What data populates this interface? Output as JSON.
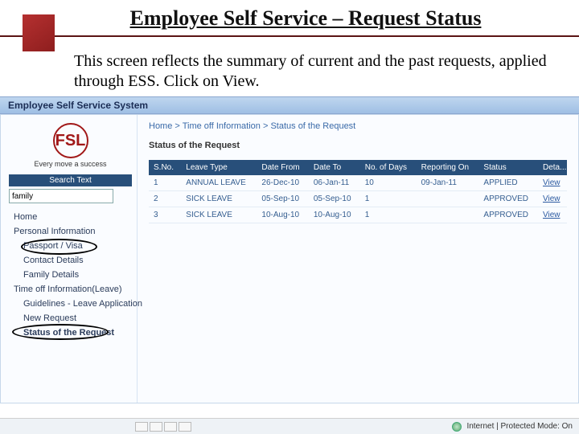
{
  "slide": {
    "title": "Employee Self Service – Request Status",
    "description": "This screen reflects the summary of current and the past requests, applied through ESS. Click on View."
  },
  "titlebar": "Employee Self Service System",
  "logo": {
    "text": "FSL",
    "tagline": "Every move a success"
  },
  "search": {
    "label": "Search Text",
    "value": "family"
  },
  "nav": {
    "home": "Home",
    "personal_info": "Personal Information",
    "passport": "Passport / Visa",
    "contact": "Contact Details",
    "family": "Family Details",
    "timeoff": "Time off Information(Leave)",
    "guidelines": "Guidelines - Leave Application",
    "newreq": "New Request",
    "status": "Status of the Request"
  },
  "breadcrumb": {
    "home": "Home",
    "timeoff": "Time off Information",
    "last": "Status of the Request"
  },
  "subheading": "Status of the Request",
  "table": {
    "headers": {
      "sno": "S.No.",
      "type": "Leave Type",
      "from": "Date From",
      "to": "Date To",
      "days": "No. of Days",
      "repon": "Reporting On",
      "status": "Status",
      "deta": "Deta..."
    },
    "rows": [
      {
        "sno": "1",
        "type": "ANNUAL LEAVE",
        "from": "26-Dec-10",
        "to": "06-Jan-11",
        "days": "10",
        "repon": "09-Jan-11",
        "status": "APPLIED",
        "view": "View"
      },
      {
        "sno": "2",
        "type": "SICK LEAVE",
        "from": "05-Sep-10",
        "to": "05-Sep-10",
        "days": "1",
        "repon": "",
        "status": "APPROVED",
        "view": "View"
      },
      {
        "sno": "3",
        "type": "SICK LEAVE",
        "from": "10-Aug-10",
        "to": "10-Aug-10",
        "days": "1",
        "repon": "",
        "status": "APPROVED",
        "view": "View"
      }
    ]
  },
  "footer": {
    "status_text": "Internet | Protected Mode: On"
  }
}
